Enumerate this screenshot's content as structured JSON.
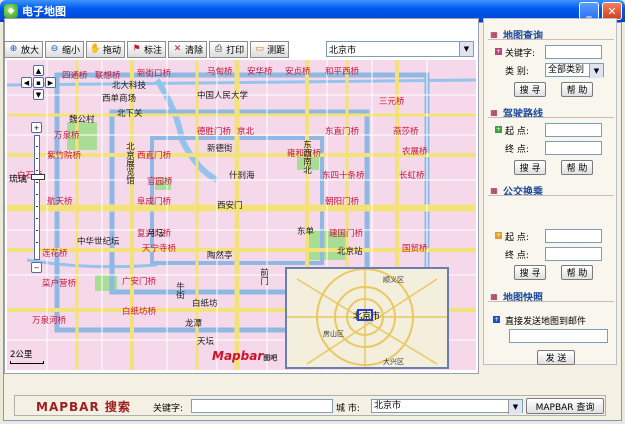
{
  "window": {
    "title": "电子地图"
  },
  "toolbar": {
    "buttons": [
      {
        "label": "放大",
        "icon": "zoom-in-icon"
      },
      {
        "label": "缩小",
        "icon": "zoom-out-icon"
      },
      {
        "label": "拖动",
        "icon": "hand-icon"
      },
      {
        "label": "标注",
        "icon": "flag-icon"
      },
      {
        "label": "清除",
        "icon": "cross-icon"
      },
      {
        "label": "打印",
        "icon": "print-icon"
      },
      {
        "label": "测距",
        "icon": "ruler-icon"
      }
    ],
    "city": "北京市"
  },
  "map": {
    "street_label": "琉璃",
    "scale": "2公里",
    "logo": "Mapbar",
    "logo_sub": "图吧",
    "labels_red": [
      "四通桥",
      "联想桥",
      "新街口桥",
      "马甸桥",
      "安华桥",
      "安贞桥",
      "和平西桥",
      "三元桥",
      "万泉桥",
      "西直门桥",
      "德胜门桥",
      "京北",
      "东直门桥",
      "燕莎桥",
      "紫竹院桥",
      "白石桥",
      "阜成门桥",
      "雍和宫桥",
      "东四十条桥",
      "农展桥",
      "航天桥",
      "官园桥",
      "朝阳门桥",
      "长虹桥",
      "复兴门桥",
      "建国门桥",
      "国贸桥",
      "莲花桥",
      "天宁寺桥",
      "广安门桥",
      "菜户营桥",
      "万泉河桥",
      "白纸坊桥"
    ],
    "labels_dark": [
      "西单商场",
      "北大科技",
      "北下关",
      "中国人民大学",
      "魏公村",
      "新德街",
      "北京展览馆",
      "什刹海",
      "西安门",
      "东单",
      "东西南北",
      "中华世纪坛",
      "月坛",
      "白纸坊",
      "牛街",
      "龙潭",
      "天坛",
      "北京站",
      "前门",
      "陶然亭"
    ],
    "overview_labels": [
      "顺义区",
      "北京市",
      "房山区",
      "大兴区"
    ]
  },
  "sidebar": {
    "map_query": {
      "title": "地图查询",
      "keyword_label": "关键字:",
      "keyword_value": "",
      "category_label": "类  别:",
      "category_value": "全部类别",
      "search_btn": "搜 寻",
      "help_btn": "帮 助"
    },
    "driving": {
      "title": "驾驶路线",
      "start_label": "起 点:",
      "end_label": "终 点:",
      "search_btn": "搜 寻",
      "help_btn": "帮 助"
    },
    "transit": {
      "title": "公交换乘",
      "start_label": "起 点:",
      "end_label": "终 点:",
      "search_btn": "搜 寻",
      "help_btn": "帮 助"
    },
    "share": {
      "title": "地图快照",
      "desc": "直接发送地图到邮件",
      "send_btn": "发 送"
    }
  },
  "bottom": {
    "brand": "MAPBAR 搜索",
    "keyword_label": "关键字:",
    "city_label": "城  市:",
    "city_value": "北京市",
    "search_btn": "MAPBAR 查询"
  },
  "colors": {
    "title_blue": "#0058ee",
    "map_bg": "#f5d9ea",
    "road_yellow": "#f3e27a",
    "road_blue": "#8fb8e2",
    "water_blue": "#94c3ee",
    "park_green": "#a9dd96"
  }
}
